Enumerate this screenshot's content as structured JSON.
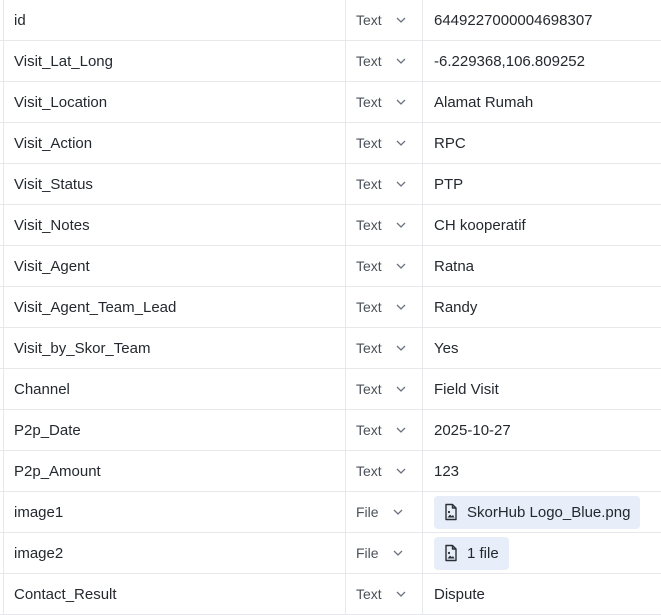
{
  "type_options": {
    "text": "Text",
    "file": "File"
  },
  "rows": [
    {
      "name": "id",
      "type": "Text",
      "value": "6449227000004698307"
    },
    {
      "name": "Visit_Lat_Long",
      "type": "Text",
      "value": "-6.229368,106.809252"
    },
    {
      "name": "Visit_Location",
      "type": "Text",
      "value": "Alamat Rumah"
    },
    {
      "name": "Visit_Action",
      "type": "Text",
      "value": "RPC"
    },
    {
      "name": "Visit_Status",
      "type": "Text",
      "value": "PTP"
    },
    {
      "name": "Visit_Notes",
      "type": "Text",
      "value": "CH kooperatif"
    },
    {
      "name": "Visit_Agent",
      "type": "Text",
      "value": "Ratna"
    },
    {
      "name": "Visit_Agent_Team_Lead",
      "type": "Text",
      "value": "Randy"
    },
    {
      "name": "Visit_by_Skor_Team",
      "type": "Text",
      "value": "Yes"
    },
    {
      "name": "Channel",
      "type": "Text",
      "value": "Field Visit"
    },
    {
      "name": "P2p_Date",
      "type": "Text",
      "value": "2025-10-27"
    },
    {
      "name": "P2p_Amount",
      "type": "Text",
      "value": "123"
    },
    {
      "name": "image1",
      "type": "File",
      "value": "SkorHub Logo_Blue.png",
      "icon": "file-image-icon"
    },
    {
      "name": "image2",
      "type": "File",
      "value": "1 file",
      "icon": "file-image-icon"
    },
    {
      "name": "Contact_Result",
      "type": "Text",
      "value": "Dispute"
    }
  ],
  "colors": {
    "pill_bg": "#e7eef9",
    "border": "#e6e8eb",
    "type_text": "#4b5159"
  }
}
